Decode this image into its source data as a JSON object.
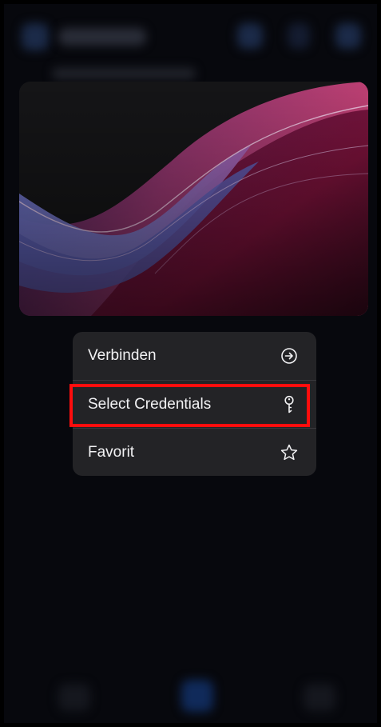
{
  "menu": {
    "items": [
      {
        "label": "Verbinden",
        "icon": "arrow-circle-right-icon"
      },
      {
        "label": "Select Credentials",
        "icon": "key-icon"
      },
      {
        "label": "Favorit",
        "icon": "star-icon"
      }
    ]
  },
  "colors": {
    "highlight": "#ff0d0d",
    "menu_background": "#232326",
    "screen_background": "#07080d"
  }
}
